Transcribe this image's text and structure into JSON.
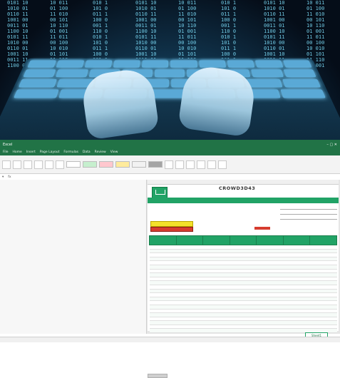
{
  "photo": {
    "code_columns": [
      "0101 10\n1010 01\n0110 11\n1001 00\n0011 01\n1100 10\n0101 11\n1010 00\n0110 01\n1001 10\n0011 11\n1100 00",
      "10 011\n01 100\n11 010\n00 101\n10 110\n01 001\n11 011\n00 100\n10 010\n01 101\n11 110\n00 001",
      "010 1\n101 0\n011 1\n100 0\n001 1\n110 0\n010 1\n101 0\n011 1\n100 0\n001 1\n110 0"
    ],
    "accent": "#7fe3ff"
  },
  "excel": {
    "window_title": "Excel",
    "tabs": [
      "File",
      "Home",
      "Insert",
      "Page Layout",
      "Formulas",
      "Data",
      "Review",
      "View"
    ],
    "sheet_title": "CROWD3D43",
    "banner": "",
    "table": {
      "headers": [
        "",
        "",
        "",
        "",
        "",
        "",
        ""
      ],
      "rows": [
        [
          "",
          "",
          "",
          "",
          "",
          "",
          ""
        ],
        [
          "",
          "",
          "",
          "",
          "",
          "",
          ""
        ],
        [
          "",
          "",
          "",
          "",
          "",
          "",
          ""
        ],
        [
          "",
          "",
          "",
          "",
          "",
          "",
          ""
        ],
        [
          "",
          "",
          "",
          "",
          "",
          "",
          ""
        ],
        [
          "",
          "",
          "",
          "",
          "",
          "",
          ""
        ],
        [
          "",
          "",
          "",
          "",
          "",
          "",
          ""
        ],
        [
          "",
          "",
          "",
          "",
          "",
          "",
          ""
        ],
        [
          "",
          "",
          "",
          "",
          "",
          "",
          ""
        ],
        [
          "",
          "",
          "",
          "",
          "",
          "",
          ""
        ],
        [
          "",
          "",
          "",
          "",
          "",
          "",
          ""
        ],
        [
          "",
          "",
          "",
          "",
          "",
          "",
          ""
        ],
        [
          "",
          "",
          "",
          "",
          "",
          "",
          ""
        ],
        [
          "",
          "",
          "",
          "",
          "",
          "",
          ""
        ],
        [
          "",
          "",
          "",
          "",
          "",
          "",
          ""
        ],
        [
          "",
          "",
          "",
          "",
          "",
          "",
          ""
        ],
        [
          "",
          "",
          "",
          "",
          "",
          "",
          ""
        ],
        [
          "",
          "",
          "",
          "",
          "",
          "",
          ""
        ],
        [
          "",
          "",
          "",
          "",
          "",
          "",
          ""
        ],
        [
          "",
          "",
          "",
          "",
          "",
          "",
          ""
        ],
        [
          "",
          "",
          "",
          "",
          "",
          "",
          ""
        ],
        [
          "",
          "",
          "",
          "",
          "",
          "",
          ""
        ],
        [
          "",
          "",
          "",
          "",
          "",
          "",
          ""
        ],
        [
          "",
          "",
          "",
          "",
          "",
          "",
          ""
        ]
      ]
    }
  },
  "colors": {
    "excel_green": "#217346",
    "table_green": "#21a366",
    "yellow": "#f4e12b",
    "red": "#d63c2f"
  }
}
